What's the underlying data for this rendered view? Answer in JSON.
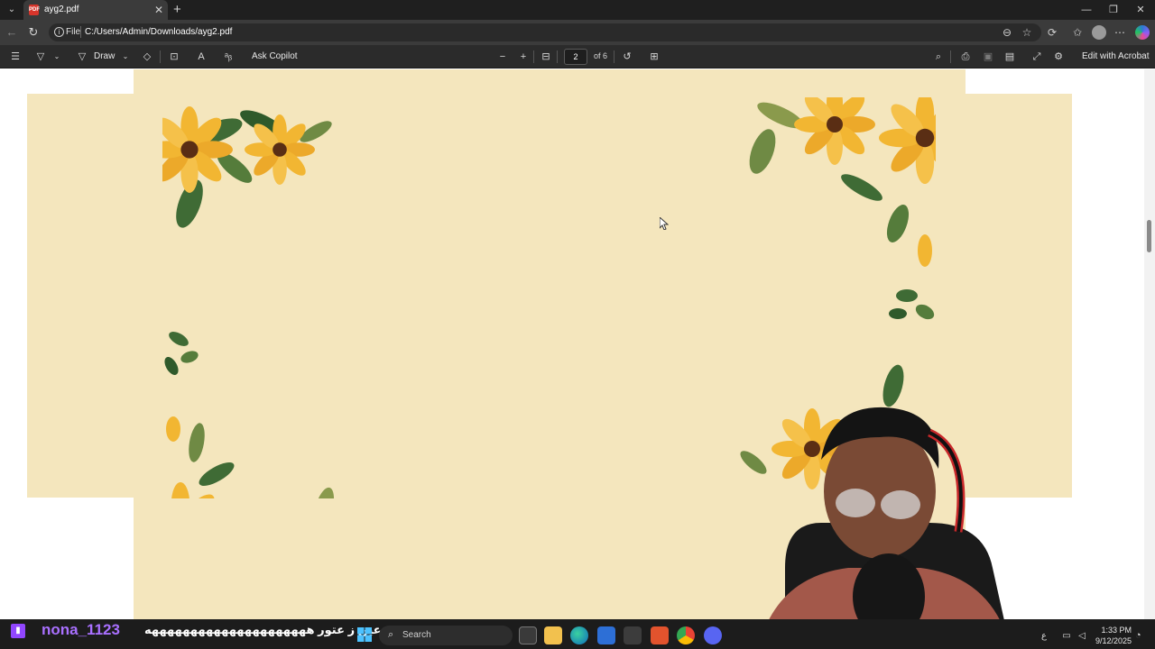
{
  "browser": {
    "tab": {
      "title": "ayg2.pdf",
      "favicon": "pdf-icon"
    },
    "address": {
      "scheme_label": "File",
      "url": "C:/Users/Admin/Downloads/ayg2.pdf"
    }
  },
  "pdf_toolbar": {
    "draw_label": "Draw",
    "ask_copilot_label": "Ask Copilot",
    "page_current": "2",
    "page_total_label": "of 6",
    "edit_label": "Edit with Acrobat"
  },
  "document": {
    "background_color": "#f4e6bd",
    "decoration": "watercolor-sunflower-border"
  },
  "stream_chat": {
    "username": "nona_1123",
    "message": "ت عين ز عتور هههههههههههههههههههههه"
  },
  "taskbar": {
    "search_placeholder": "Search",
    "language": "ع",
    "time": "1:33 PM",
    "date": "9/12/2025"
  },
  "colors": {
    "browser_dark": "#1f1f1f",
    "toolbar": "#2b2b2b",
    "twitch_purple": "#a970ff",
    "page_cream": "#f4e6bd",
    "petal_yellow": "#f2b632",
    "leaf_green": "#3f6b35"
  }
}
